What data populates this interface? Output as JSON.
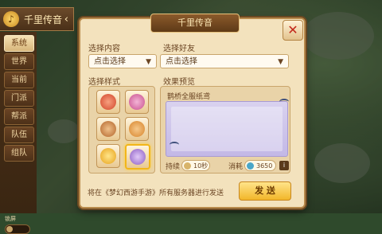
{
  "header": {
    "title": "千里传音",
    "back_symbol": "‹"
  },
  "tabs": {
    "items": [
      "系统",
      "世界",
      "当前",
      "门派",
      "帮派",
      "队伍",
      "组队"
    ],
    "active": "系统",
    "lock_label": "锁屏"
  },
  "dialog": {
    "title": "千里传音",
    "close_symbol": "✕",
    "content_label": "选择内容",
    "content_select": "点击选择",
    "friend_label": "选择好友",
    "friend_select": "点击选择",
    "style_label": "选择样式",
    "preview_label": "效果预览",
    "preview_name": "鹊桥全服纸鸢",
    "duration_label": "持续",
    "duration_value": "10秒",
    "cost_label": "消耗",
    "cost_value": "3650",
    "info_symbol": "i",
    "footer_text": "将在《梦幻西游手游》所有服务器进行发送",
    "send_label": "发 送"
  },
  "styles": [
    {
      "icon": "phoenix-style-icon",
      "color": "#d2452a"
    },
    {
      "icon": "peach-blossom-style-icon",
      "color": "#c94f8e"
    },
    {
      "icon": "sword-style-icon",
      "color": "#b2642a"
    },
    {
      "icon": "lantern-style-icon",
      "color": "#d7842b"
    },
    {
      "icon": "gold-star-style-icon",
      "color": "#e7a21b"
    },
    {
      "icon": "purple-flower-style-icon",
      "color": "#8c5cc4"
    }
  ],
  "selected_style_index": 5,
  "colors": {
    "accent": "#f2b62a",
    "panel": "#f3e2bd",
    "border": "#b88a4c"
  }
}
